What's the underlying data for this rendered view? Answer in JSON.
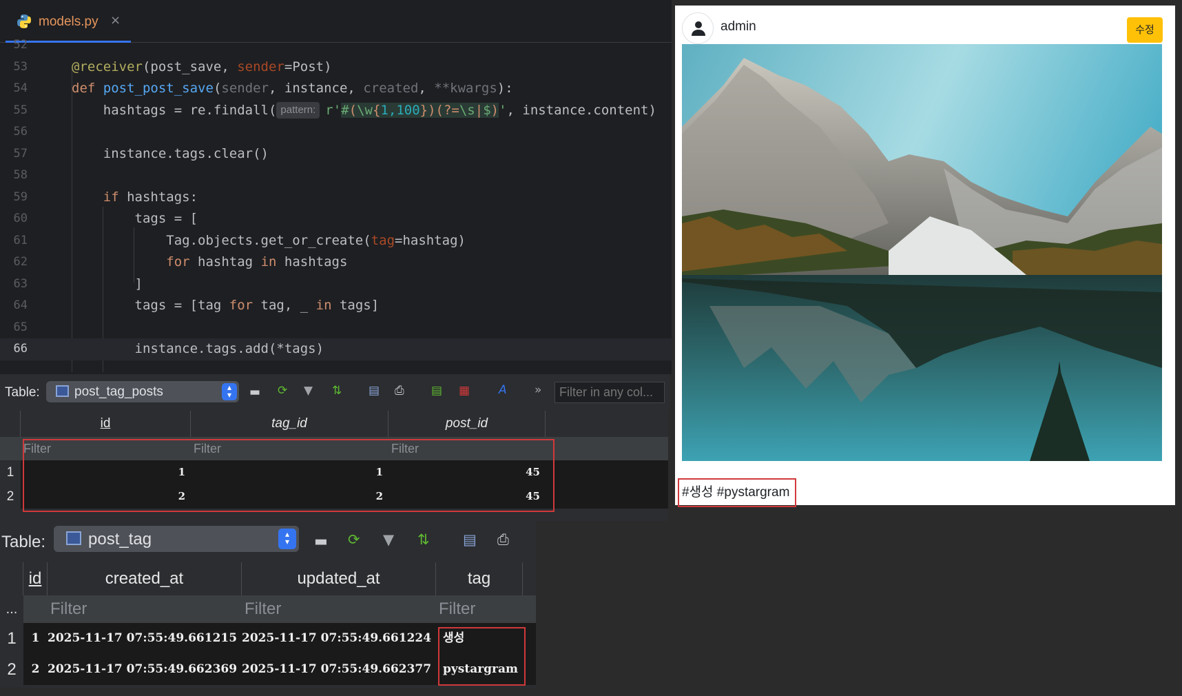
{
  "editor": {
    "tab_label": "models.py",
    "tab_close": "×",
    "lines": [
      {
        "n": "52"
      },
      {
        "n": "53"
      },
      {
        "n": "54"
      },
      {
        "n": "55"
      },
      {
        "n": "56"
      },
      {
        "n": "57"
      },
      {
        "n": "58"
      },
      {
        "n": "59"
      },
      {
        "n": "60"
      },
      {
        "n": "61"
      },
      {
        "n": "62"
      },
      {
        "n": "63"
      },
      {
        "n": "64"
      },
      {
        "n": "65"
      },
      {
        "n": "66"
      }
    ],
    "hint_pattern": "pattern:"
  },
  "table1": {
    "label": "Table:",
    "name": "post_tag_posts",
    "filter_placeholder": "Filter in any col...",
    "columns": [
      "id",
      "tag_id",
      "post_id"
    ],
    "filter": "Filter",
    "rows": [
      {
        "n": "1",
        "cells": [
          "1",
          "1",
          "45"
        ]
      },
      {
        "n": "2",
        "cells": [
          "2",
          "2",
          "45"
        ]
      }
    ]
  },
  "table2": {
    "label": "Table:",
    "name": "post_tag",
    "columns": [
      "id",
      "created_at",
      "updated_at",
      "tag"
    ],
    "filter": "Filter",
    "ellipsis": "...",
    "rows": [
      {
        "n": "1",
        "cells": [
          "1",
          "2025-11-17 07:55:49.661215",
          "2025-11-17 07:55:49.661224",
          "생성"
        ]
      },
      {
        "n": "2",
        "cells": [
          "2",
          "2025-11-17 07:55:49.662369",
          "2025-11-17 07:55:49.662377",
          "pystargram"
        ]
      }
    ]
  },
  "post": {
    "username": "admin",
    "edit_label": "수정",
    "caption": "#생성 #pystargram"
  },
  "colors": {
    "highlight_box": "#d0393b",
    "edit_button": "#ffc107",
    "editor_bg": "#1e1f22"
  }
}
